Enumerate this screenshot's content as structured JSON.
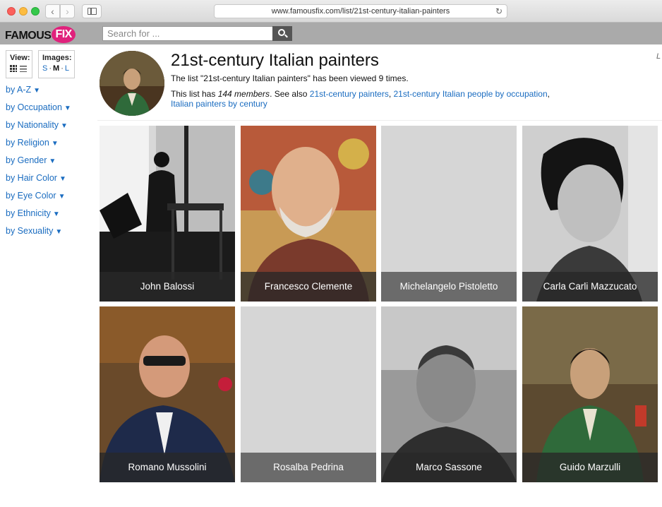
{
  "browser": {
    "url": "www.famousfix.com/list/21st-century-italian-painters"
  },
  "site": {
    "logo_main": "FAMOUS",
    "logo_fix": "FIX",
    "search_placeholder": "Search for ..."
  },
  "sidebar": {
    "view_label": "View:",
    "images_label": "Images:",
    "sizes": [
      "S",
      "M",
      "L"
    ],
    "selected_size": "M",
    "filters": [
      "by A-Z",
      "by Occupation",
      "by Nationality",
      "by Religion",
      "by Gender",
      "by Hair Color",
      "by Eye Color",
      "by Ethnicity",
      "by Sexuality"
    ]
  },
  "header": {
    "title": "21st-century Italian painters",
    "viewed_text": "The list \"21st-century Italian painters\" has been viewed 9 times.",
    "members_prefix": "This list has ",
    "members_count": "144 members",
    "see_also_text": ". See also ",
    "link1": "21st-century painters",
    "link2": "21st-century Italian people by occupation",
    "link3": "Italian painters by century",
    "corner": "L"
  },
  "people": [
    {
      "name": "John Balossi",
      "photo": "bw-studio"
    },
    {
      "name": "Francesco Clemente",
      "photo": "color-portrait"
    },
    {
      "name": "Michelangelo Pistoletto",
      "photo": "none"
    },
    {
      "name": "Carla Carli Mazzucato",
      "photo": "bw-portrait"
    },
    {
      "name": "Romano Mussolini",
      "photo": "color-portrait"
    },
    {
      "name": "Rosalba Pedrina",
      "photo": "none"
    },
    {
      "name": "Marco Sassone",
      "photo": "bw-portrait"
    },
    {
      "name": "Guido Marzulli",
      "photo": "painted-portrait"
    }
  ]
}
